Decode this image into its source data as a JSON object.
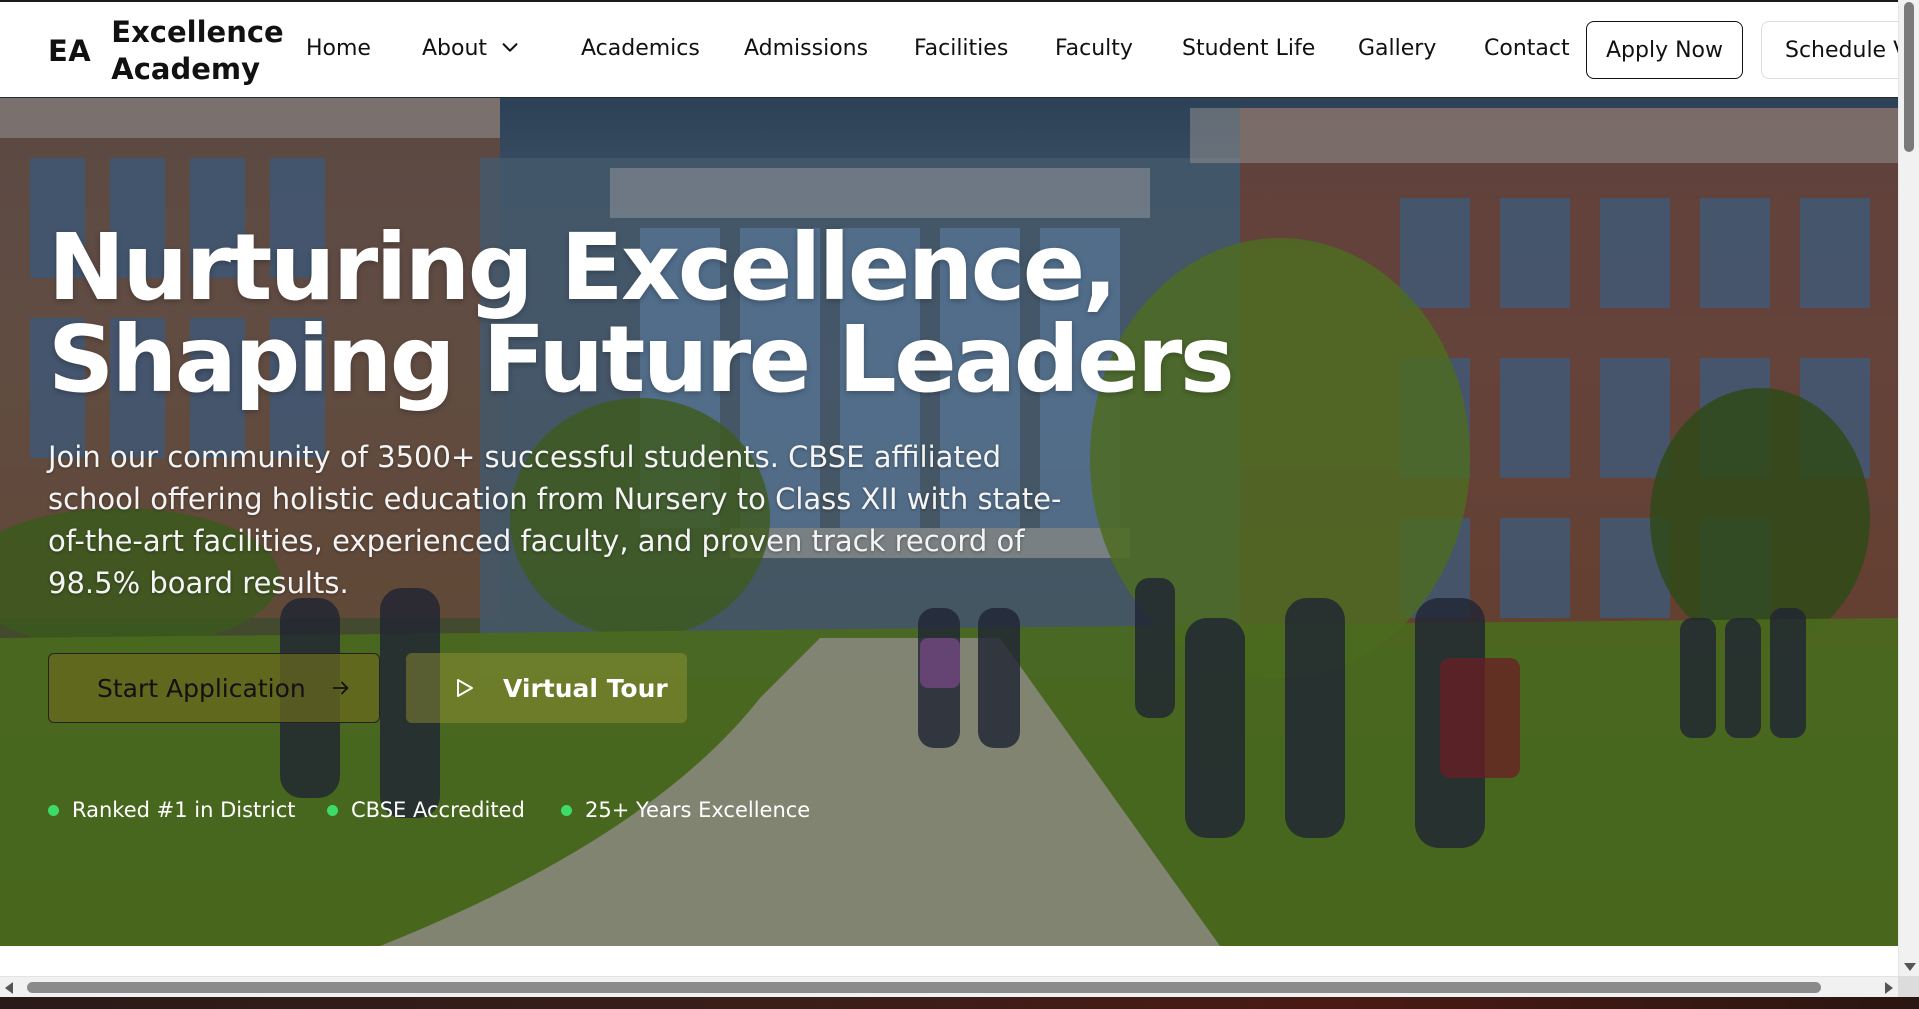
{
  "brand": {
    "mark": "EA",
    "name": "Excellence Academy"
  },
  "nav": {
    "items": [
      {
        "label": "Home"
      },
      {
        "label": "About",
        "dropdown": true
      },
      {
        "label": "Academics"
      },
      {
        "label": "Admissions"
      },
      {
        "label": "Facilities"
      },
      {
        "label": "Faculty"
      },
      {
        "label": "Student Life"
      },
      {
        "label": "Gallery"
      },
      {
        "label": "Contact"
      }
    ],
    "apply_label": "Apply Now",
    "visit_label": "Schedule Vi"
  },
  "hero": {
    "title": "Nurturing Excellence, Shaping Future Leaders",
    "description": "Join our community of 3500+ successful students. CBSE affiliated school offering holistic education from Nursery to Class XII with state-of-the-art facilities, experienced faculty, and proven track record of 98.5% board results.",
    "start_label": "Start Application",
    "tour_label": "Virtual Tour",
    "badges": [
      {
        "label": "Ranked #1 in District"
      },
      {
        "label": "CBSE Accredited"
      },
      {
        "label": "25+ Years Excellence"
      }
    ],
    "background": "school-campus-photo"
  },
  "icons": {
    "dropdown": "chevron-down-icon",
    "start": "arrow-right-icon",
    "tour": "play-icon",
    "badge": "green-dot-icon"
  },
  "colors": {
    "badge_dot": "#3ddc6a",
    "start_button_bg": "#69691e",
    "tour_button_bg": "#969637"
  }
}
